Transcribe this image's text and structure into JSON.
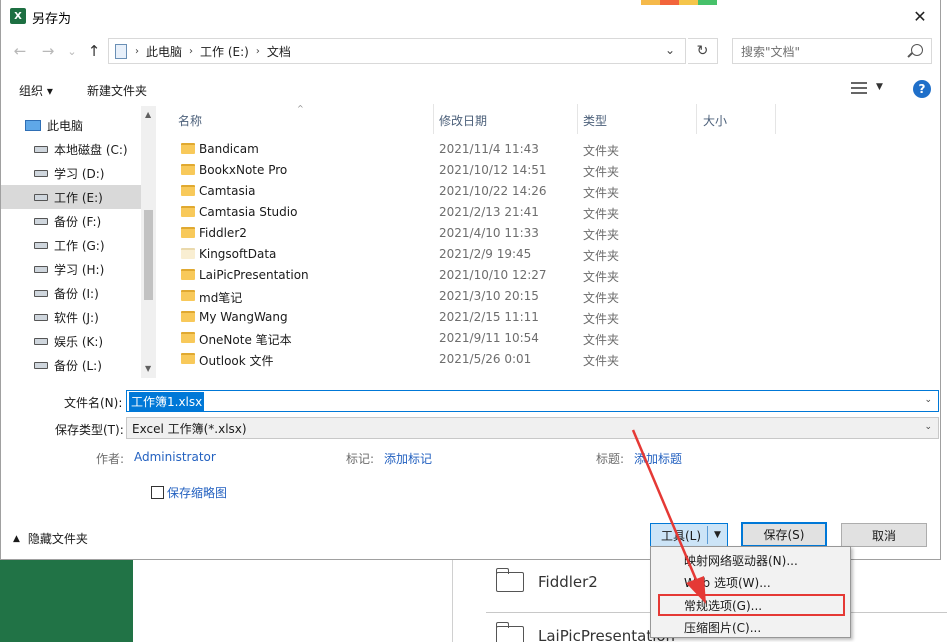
{
  "window": {
    "title": "另存为",
    "app_icon": "X",
    "close": "✕"
  },
  "deco_colors": [
    "#f5b94a",
    "#f2643b",
    "#f5c54a",
    "#47c16a"
  ],
  "nav": {
    "back": "←",
    "forward": "→",
    "recent": "⌄",
    "up": "↑",
    "breadcrumbs": [
      "此电脑",
      "工作 (E:)",
      "文档"
    ],
    "sep": "›",
    "addr_dropdown": "⌄",
    "refresh": "↻",
    "search_placeholder": "搜索\"文档\""
  },
  "toolbar": {
    "organize": "组织 ▾",
    "new_folder": "新建文件夹",
    "view_dd": "▼",
    "help": "?"
  },
  "tree": [
    {
      "label": "此电脑",
      "type": "pc"
    },
    {
      "label": "本地磁盘 (C:)",
      "type": "drive"
    },
    {
      "label": "学习 (D:)",
      "type": "drive"
    },
    {
      "label": "工作 (E:)",
      "type": "drive",
      "selected": true
    },
    {
      "label": "备份 (F:)",
      "type": "drive"
    },
    {
      "label": "工作 (G:)",
      "type": "drive"
    },
    {
      "label": "学习 (H:)",
      "type": "drive"
    },
    {
      "label": "备份 (I:)",
      "type": "drive"
    },
    {
      "label": "软件 (J:)",
      "type": "drive"
    },
    {
      "label": "娱乐 (K:)",
      "type": "drive"
    },
    {
      "label": "备份 (L:)",
      "type": "drive"
    }
  ],
  "columns": {
    "name": "名称",
    "modified": "修改日期",
    "type": "类型",
    "size": "大小"
  },
  "files": [
    {
      "name": "Bandicam",
      "date": "2021/11/4 11:43",
      "type": "文件夹"
    },
    {
      "name": "BookxNote Pro",
      "date": "2021/10/12 14:51",
      "type": "文件夹"
    },
    {
      "name": "Camtasia",
      "date": "2021/10/22 14:26",
      "type": "文件夹"
    },
    {
      "name": "Camtasia Studio",
      "date": "2021/2/13 21:41",
      "type": "文件夹"
    },
    {
      "name": "Fiddler2",
      "date": "2021/4/10 11:33",
      "type": "文件夹"
    },
    {
      "name": "KingsoftData",
      "date": "2021/2/9 19:45",
      "type": "文件夹",
      "plain": true
    },
    {
      "name": "LaiPicPresentation",
      "date": "2021/10/10 12:27",
      "type": "文件夹"
    },
    {
      "name": "md笔记",
      "date": "2021/3/10 20:15",
      "type": "文件夹"
    },
    {
      "name": "My WangWang",
      "date": "2021/2/15 11:11",
      "type": "文件夹"
    },
    {
      "name": "OneNote 笔记本",
      "date": "2021/9/11 10:54",
      "type": "文件夹"
    },
    {
      "name": "Outlook 文件",
      "date": "2021/5/26 0:01",
      "type": "文件夹"
    }
  ],
  "form": {
    "filename_label": "文件名(N):",
    "filename_value": "工作簿1.xlsx",
    "savetype_label": "保存类型(T):",
    "savetype_value": "Excel 工作簿(*.xlsx)",
    "author_label": "作者:",
    "author_value": "Administrator",
    "tags_label": "标记:",
    "tags_value": "添加标记",
    "title_label": "标题:",
    "title_value": "添加标题",
    "thumbnail_label": "保存缩略图",
    "hide_folders": "隐藏文件夹",
    "hide_caret": "▲",
    "dd": "⌄"
  },
  "buttons": {
    "tools": "工具(L)",
    "tools_dd": "▼",
    "save": "保存(S)",
    "cancel": "取消"
  },
  "menu": [
    "映射网络驱动器(N)...",
    "Web 选项(W)...",
    "常规选项(G)...",
    "压缩图片(C)..."
  ],
  "background": {
    "row1": "Fiddler2",
    "row2": "LaiPicPresentation"
  },
  "accent_colors": {
    "excel_green": "#217346",
    "highlight_red": "#e53935",
    "select_blue": "#0078d7",
    "link_blue": "#2361c0"
  }
}
